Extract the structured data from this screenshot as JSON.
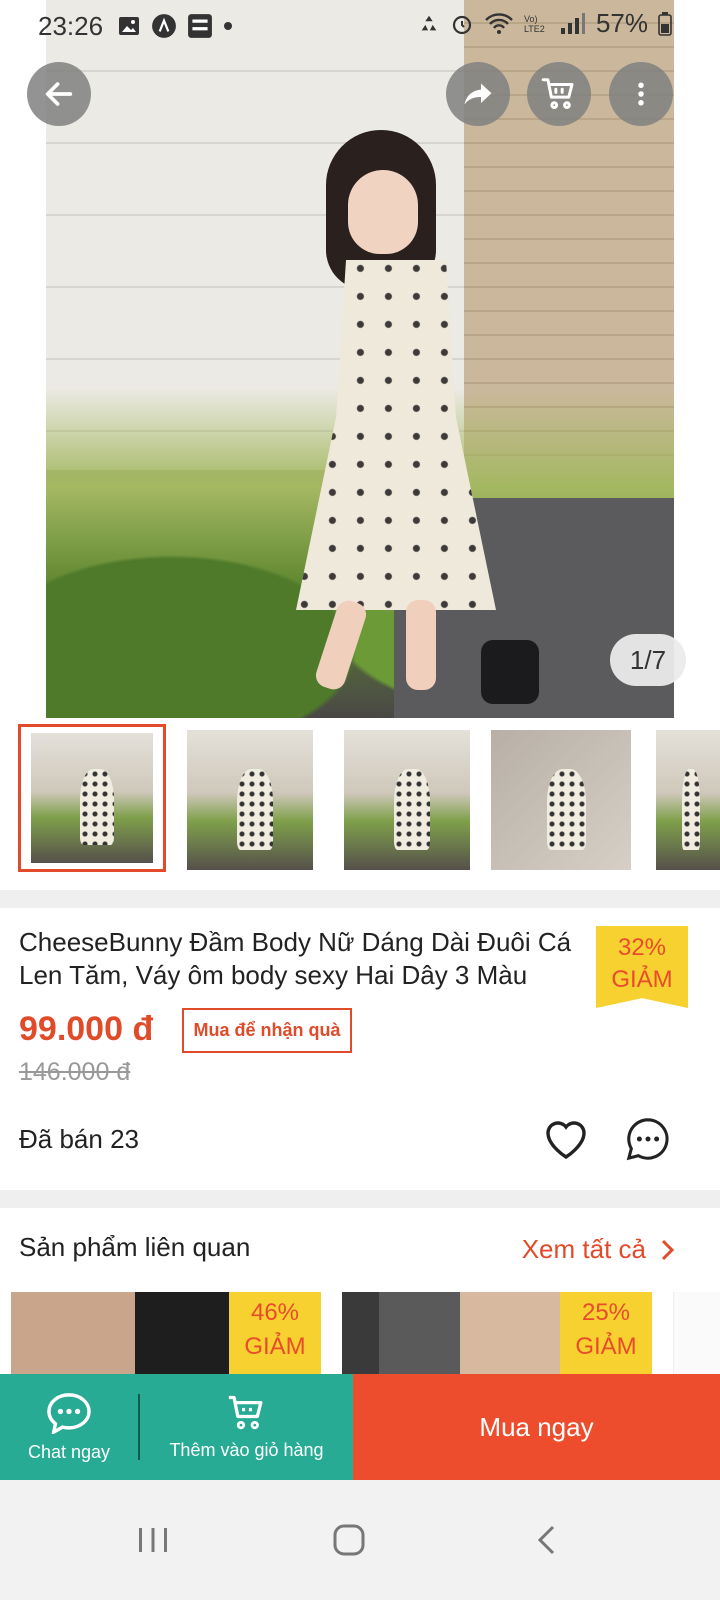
{
  "status_bar": {
    "time": "23:26",
    "battery": "57%",
    "network": "Vo) LTE2"
  },
  "gallery": {
    "counter": "1/7"
  },
  "product": {
    "title": "CheeseBunny Đầm Body Nữ Dáng Dài Đuôi Cá Len Tăm, Váy ôm body sexy Hai Dây 3 Màu",
    "discount_percent": "32%",
    "discount_label": "GIẢM",
    "price": "99.000 đ",
    "gift_tag": "Mua để nhận quà",
    "old_price": "146.000 đ",
    "sold": "Đã bán 23"
  },
  "related": {
    "title": "Sản phẩm liên quan",
    "see_all": "Xem tất cả",
    "items": [
      {
        "discount_percent": "46%",
        "discount_label": "GIẢM"
      },
      {
        "discount_percent": "25%",
        "discount_label": "GIẢM"
      }
    ]
  },
  "actions": {
    "chat": "Chat ngay",
    "add_to_cart": "Thêm vào giỏ hàng",
    "buy_now": "Mua ngay"
  },
  "colors": {
    "accent": "#ee4d2d",
    "action_green": "#27ab94",
    "badge_yellow": "#f7d130"
  }
}
